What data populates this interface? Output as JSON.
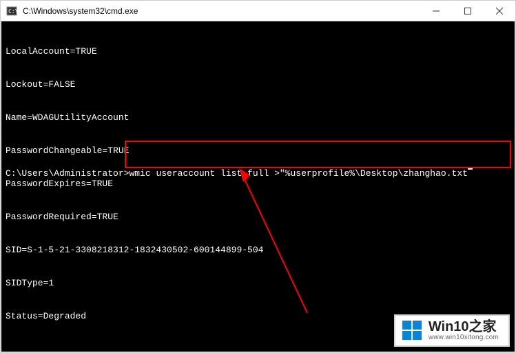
{
  "window": {
    "title": "C:\\Windows\\system32\\cmd.exe"
  },
  "terminal": {
    "output": [
      "LocalAccount=TRUE",
      "Lockout=FALSE",
      "Name=WDAGUtilityAccount",
      "PasswordChangeable=TRUE",
      "PasswordExpires=TRUE",
      "PasswordRequired=TRUE",
      "SID=S-1-5-21-3308218312-1832430502-600144899-504",
      "SIDType=1",
      "Status=Degraded"
    ],
    "prompt": "C:\\Users\\Administrator>",
    "command": "wmic useraccount list full >\"%userprofile%\\Desktop\\zhanghao.txt"
  },
  "watermark": {
    "title": "Win10之家",
    "url": "www.win10xitong.com"
  }
}
